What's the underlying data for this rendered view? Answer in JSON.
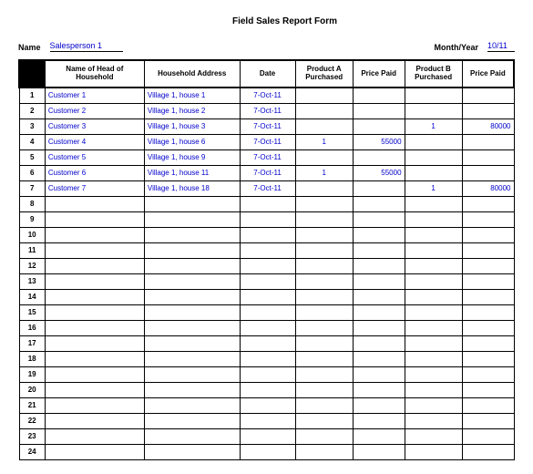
{
  "title": "Field Sales Report Form",
  "meta": {
    "name_label": "Name",
    "name_value": "Salesperson 1",
    "monthyear_label": "Month/Year",
    "monthyear_value": "10/11"
  },
  "headers": {
    "name": "Name of Head of Household",
    "address": "Household Address",
    "date": "Date",
    "prodA": "Product A Purchased",
    "priceA": "Price Paid",
    "prodB": "Product B Purchased",
    "priceB": "Price Paid"
  },
  "rows": [
    {
      "n": "1",
      "name": "Customer 1",
      "addr": "Village 1, house 1",
      "date": "7-Oct-11",
      "pa": "",
      "ppa": "",
      "pb": "",
      "ppb": ""
    },
    {
      "n": "2",
      "name": "Customer 2",
      "addr": "Village 1, house 2",
      "date": "7-Oct-11",
      "pa": "",
      "ppa": "",
      "pb": "",
      "ppb": ""
    },
    {
      "n": "3",
      "name": "Customer 3",
      "addr": "Village 1, house 3",
      "date": "7-Oct-11",
      "pa": "",
      "ppa": "",
      "pb": "1",
      "ppb": "80000"
    },
    {
      "n": "4",
      "name": "Customer 4",
      "addr": "Village 1, house 6",
      "date": "7-Oct-11",
      "pa": "1",
      "ppa": "55000",
      "pb": "",
      "ppb": ""
    },
    {
      "n": "5",
      "name": "Customer 5",
      "addr": "Village 1, house 9",
      "date": "7-Oct-11",
      "pa": "",
      "ppa": "",
      "pb": "",
      "ppb": ""
    },
    {
      "n": "6",
      "name": "Customer 6",
      "addr": "Village 1, house 11",
      "date": "7-Oct-11",
      "pa": "1",
      "ppa": "55000",
      "pb": "",
      "ppb": ""
    },
    {
      "n": "7",
      "name": "Customer 7",
      "addr": "Village 1, house 18",
      "date": "7-Oct-11",
      "pa": "",
      "ppa": "",
      "pb": "1",
      "ppb": "80000"
    },
    {
      "n": "8",
      "name": "",
      "addr": "",
      "date": "",
      "pa": "",
      "ppa": "",
      "pb": "",
      "ppb": ""
    },
    {
      "n": "9",
      "name": "",
      "addr": "",
      "date": "",
      "pa": "",
      "ppa": "",
      "pb": "",
      "ppb": ""
    },
    {
      "n": "10",
      "name": "",
      "addr": "",
      "date": "",
      "pa": "",
      "ppa": "",
      "pb": "",
      "ppb": ""
    },
    {
      "n": "11",
      "name": "",
      "addr": "",
      "date": "",
      "pa": "",
      "ppa": "",
      "pb": "",
      "ppb": ""
    },
    {
      "n": "12",
      "name": "",
      "addr": "",
      "date": "",
      "pa": "",
      "ppa": "",
      "pb": "",
      "ppb": ""
    },
    {
      "n": "13",
      "name": "",
      "addr": "",
      "date": "",
      "pa": "",
      "ppa": "",
      "pb": "",
      "ppb": ""
    },
    {
      "n": "14",
      "name": "",
      "addr": "",
      "date": "",
      "pa": "",
      "ppa": "",
      "pb": "",
      "ppb": ""
    },
    {
      "n": "15",
      "name": "",
      "addr": "",
      "date": "",
      "pa": "",
      "ppa": "",
      "pb": "",
      "ppb": ""
    },
    {
      "n": "16",
      "name": "",
      "addr": "",
      "date": "",
      "pa": "",
      "ppa": "",
      "pb": "",
      "ppb": ""
    },
    {
      "n": "17",
      "name": "",
      "addr": "",
      "date": "",
      "pa": "",
      "ppa": "",
      "pb": "",
      "ppb": ""
    },
    {
      "n": "18",
      "name": "",
      "addr": "",
      "date": "",
      "pa": "",
      "ppa": "",
      "pb": "",
      "ppb": ""
    },
    {
      "n": "19",
      "name": "",
      "addr": "",
      "date": "",
      "pa": "",
      "ppa": "",
      "pb": "",
      "ppb": ""
    },
    {
      "n": "20",
      "name": "",
      "addr": "",
      "date": "",
      "pa": "",
      "ppa": "",
      "pb": "",
      "ppb": ""
    },
    {
      "n": "21",
      "name": "",
      "addr": "",
      "date": "",
      "pa": "",
      "ppa": "",
      "pb": "",
      "ppb": ""
    },
    {
      "n": "22",
      "name": "",
      "addr": "",
      "date": "",
      "pa": "",
      "ppa": "",
      "pb": "",
      "ppb": ""
    },
    {
      "n": "23",
      "name": "",
      "addr": "",
      "date": "",
      "pa": "",
      "ppa": "",
      "pb": "",
      "ppb": ""
    },
    {
      "n": "24",
      "name": "",
      "addr": "",
      "date": "",
      "pa": "",
      "ppa": "",
      "pb": "",
      "ppb": ""
    }
  ]
}
